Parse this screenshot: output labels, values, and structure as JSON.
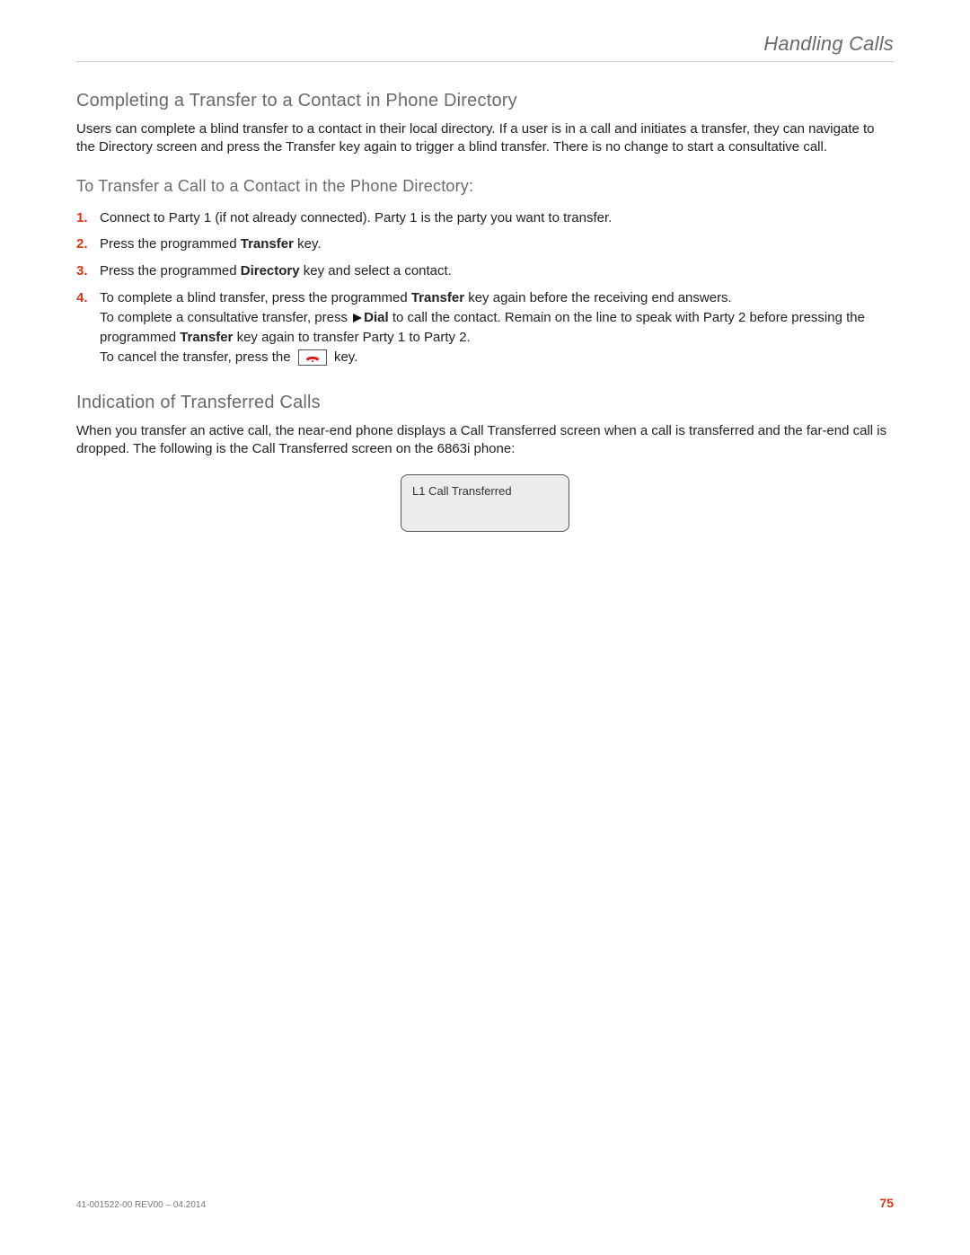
{
  "header": {
    "running_title": "Handling Calls"
  },
  "section1": {
    "title": "Completing a Transfer to a Contact in Phone Directory",
    "intro": "Users can complete a blind transfer to a contact in their local directory. If a user is in a call and initiates a transfer, they can navigate to the Directory screen and press the Transfer key again to trigger a blind transfer. There is no change to start a consultative call.",
    "procedure_title": "To Transfer a Call to a Contact in the Phone Directory:",
    "steps": {
      "s1_num": "1.",
      "s1_text": "Connect to Party 1 (if not already connected). Party 1 is the party you want to transfer.",
      "s2_num": "2.",
      "s2_a": "Press the ",
      "s2_b": "programmed ",
      "s2_c": "Transfer",
      "s2_d": " key.",
      "s3_num": "3.",
      "s3_a": "Press the programmed ",
      "s3_b": "Directory",
      "s3_c": " key and select a contact.",
      "s4_num": "4.",
      "s4_a": "To complete a blind transfer, press the programmed ",
      "s4_b": "Transfer",
      "s4_c": " key  again before the receiving end answers.",
      "s4_d": "To complete a consultative transfer, press ",
      "s4_e": "Dial",
      "s4_f": " to call the contact. Remain on the line to speak with Party 2 before pressing the programmed ",
      "s4_g": "Transfer",
      "s4_h": " key again to transfer Party 1 to Party 2.",
      "s4_i": "To cancel the transfer, press the  ",
      "s4_j": " key."
    }
  },
  "section2": {
    "title": "Indication of Transferred Calls",
    "intro": "When you transfer an active call, the near-end phone displays a Call Transferred screen when a call is transferred and the far-end call is dropped. The following is the Call Transferred screen on the 6863i phone:",
    "screen_text": "L1   Call Transferred"
  },
  "footer": {
    "doc_id": "41-001522-00 REV00 – 04.2014",
    "page": "75"
  },
  "icons": {
    "dial": "dial-play-icon",
    "hangup": "hangup-icon"
  }
}
